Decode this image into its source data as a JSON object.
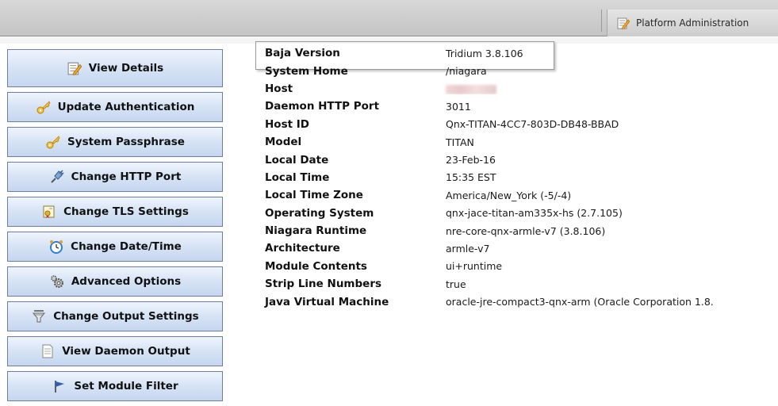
{
  "topbar": {
    "platform_tab_label": "Platform Administration"
  },
  "nav": {
    "items": [
      {
        "label": "View Details",
        "icon": "edit-icon"
      },
      {
        "label": "Update Authentication",
        "icon": "key-icon"
      },
      {
        "label": "System Passphrase",
        "icon": "key-icon"
      },
      {
        "label": "Change HTTP Port",
        "icon": "plug-icon"
      },
      {
        "label": "Change TLS Settings",
        "icon": "certificate-icon"
      },
      {
        "label": "Change Date/Time",
        "icon": "clock-icon"
      },
      {
        "label": "Advanced Options",
        "icon": "gears-icon"
      },
      {
        "label": "Change Output Settings",
        "icon": "filter-icon"
      },
      {
        "label": "View Daemon Output",
        "icon": "document-icon"
      },
      {
        "label": "Set Module Filter",
        "icon": "flag-icon"
      }
    ]
  },
  "properties": [
    {
      "key": "Baja Version",
      "value": "Tridium 3.8.106"
    },
    {
      "key": "System Home",
      "value": "/niagara"
    },
    {
      "key": "Host",
      "value": ""
    },
    {
      "key": "Daemon HTTP Port",
      "value": "3011"
    },
    {
      "key": "Host ID",
      "value": "Qnx-TITAN-4CC7-803D-DB48-BBAD"
    },
    {
      "key": "Model",
      "value": "TITAN"
    },
    {
      "key": "Local Date",
      "value": "23-Feb-16"
    },
    {
      "key": "Local Time",
      "value": "15:35 EST"
    },
    {
      "key": "Local Time Zone",
      "value": "America/New_York (-5/-4)"
    },
    {
      "key": "Operating System",
      "value": "qnx-jace-titan-am335x-hs (2.7.105)"
    },
    {
      "key": "Niagara Runtime",
      "value": "nre-core-qnx-armle-v7 (3.8.106)"
    },
    {
      "key": "Architecture",
      "value": "armle-v7"
    },
    {
      "key": "Module Contents",
      "value": "ui+runtime"
    },
    {
      "key": "Strip Line Numbers",
      "value": "true"
    },
    {
      "key": "Java Virtual Machine",
      "value": "oracle-jre-compact3-qnx-arm (Oracle Corporation 1.8."
    }
  ]
}
